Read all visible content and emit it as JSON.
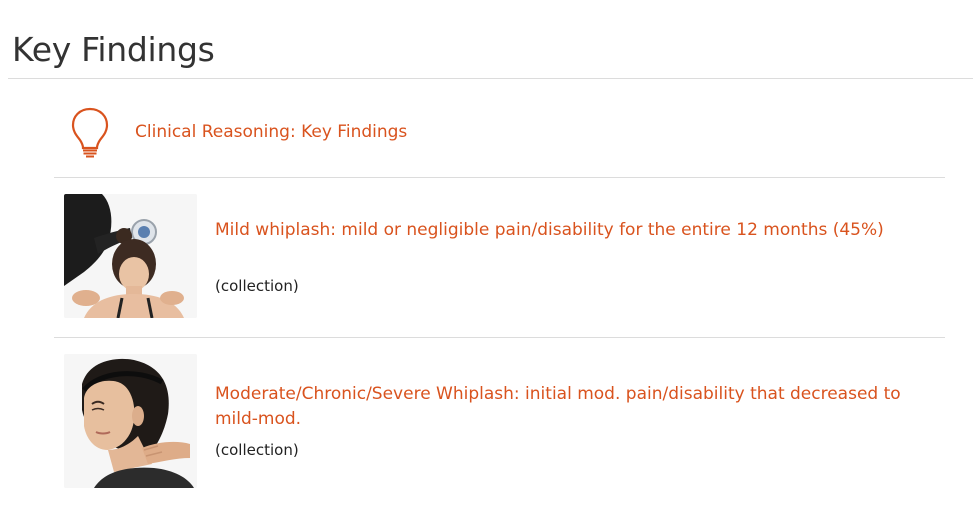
{
  "page": {
    "title": "Key Findings"
  },
  "reasoning": {
    "icon": "lightbulb-icon",
    "label": "Clinical Reasoning: Key Findings",
    "color": "#d9531e"
  },
  "items": [
    {
      "title": "Mild whiplash: mild or negligible pain/disability for the entire 12 months (45%)",
      "type": "(collection)",
      "image": "neck-exam-photo"
    },
    {
      "title": "Moderate/Chronic/Severe Whiplash: initial mod. pain/disability that decreased to mild-mod.",
      "type": "(collection)",
      "image": "neck-pain-photo"
    }
  ],
  "colors": {
    "accent": "#d9531e",
    "divider": "#dcdcdc",
    "heading": "#333333"
  }
}
